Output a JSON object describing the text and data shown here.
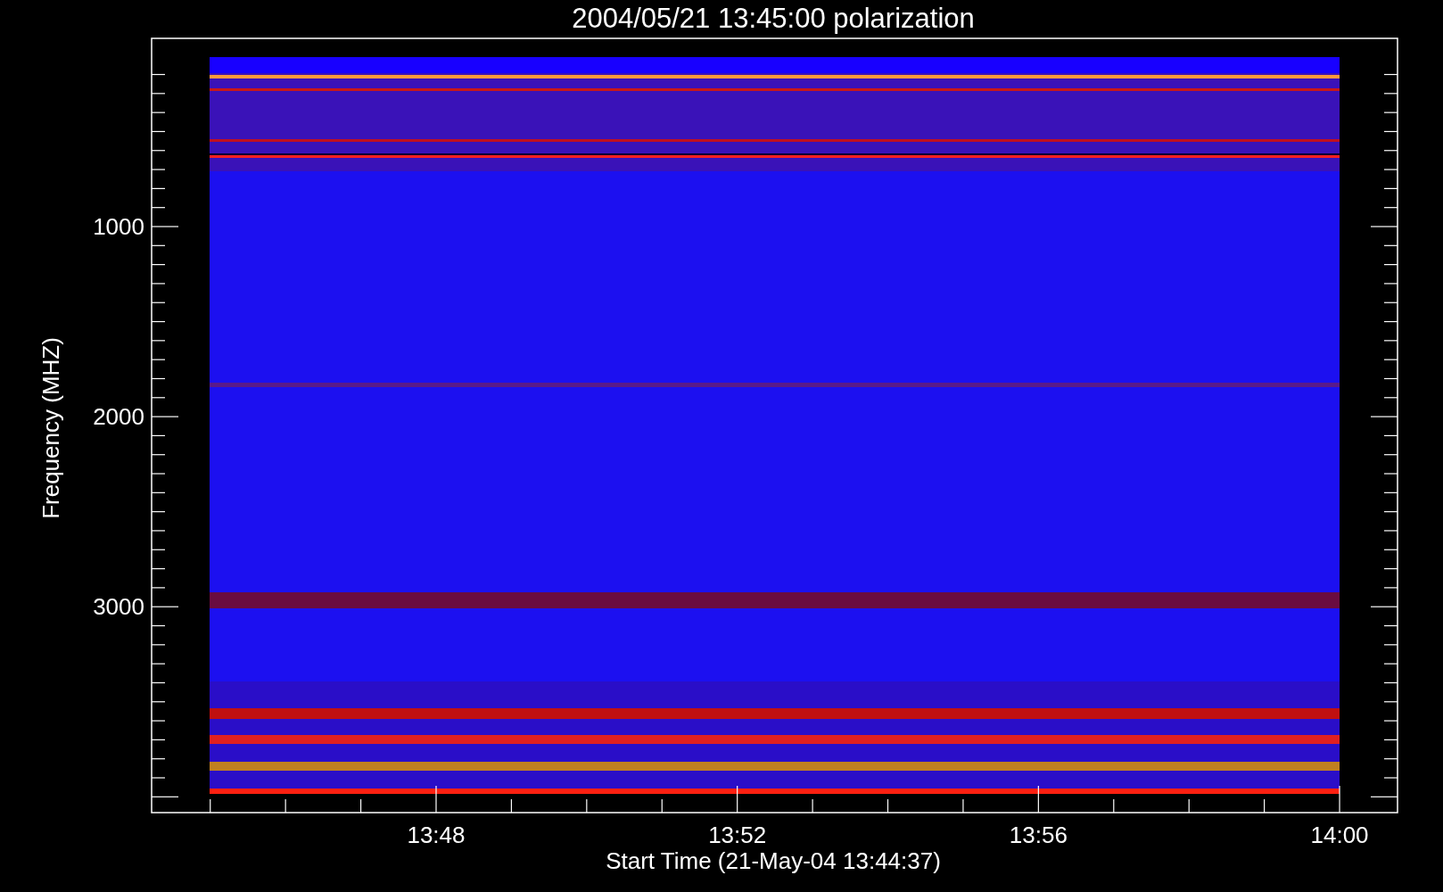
{
  "title": "2004/05/21 13:45:00 polarization",
  "y_axis": {
    "label": "Frequency (MHZ)",
    "ticks": [
      "1000",
      "2000",
      "3000"
    ]
  },
  "x_axis": {
    "label": "Start Time (21-May-04 13:44:37)",
    "ticks": [
      "13:48",
      "13:52",
      "13:56",
      "14:00"
    ]
  }
}
